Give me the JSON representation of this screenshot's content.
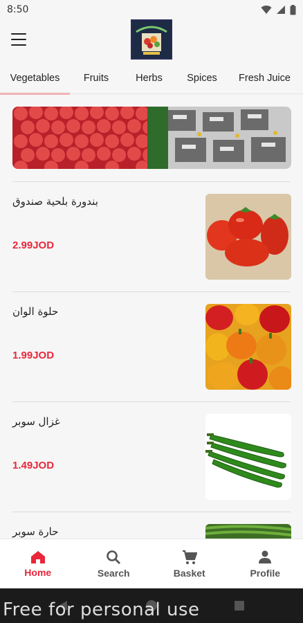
{
  "status": {
    "time": "8:50"
  },
  "tabs": [
    {
      "label": "Vegetables",
      "active": true
    },
    {
      "label": "Fruits",
      "active": false
    },
    {
      "label": "Herbs",
      "active": false
    },
    {
      "label": "Spices",
      "active": false
    },
    {
      "label": "Fresh Juice",
      "active": false
    }
  ],
  "products": [
    {
      "name": "بندورة بلحية صندوق",
      "price": "2.99JOD"
    },
    {
      "name": "حلوة الوان",
      "price": "1.99JOD"
    },
    {
      "name": "غزال سوبر",
      "price": "1.49JOD"
    },
    {
      "name": "حارة سوبر",
      "price": ""
    }
  ],
  "bottom_nav": [
    {
      "label": "Home",
      "icon": "home-icon",
      "active": true
    },
    {
      "label": "Search",
      "icon": "search-icon",
      "active": false
    },
    {
      "label": "Basket",
      "icon": "cart-icon",
      "active": false
    },
    {
      "label": "Profile",
      "icon": "person-icon",
      "active": false
    }
  ],
  "watermark": "Free for personal use",
  "colors": {
    "accent": "#e8273b",
    "tab_indicator": "#f2b1b4"
  }
}
